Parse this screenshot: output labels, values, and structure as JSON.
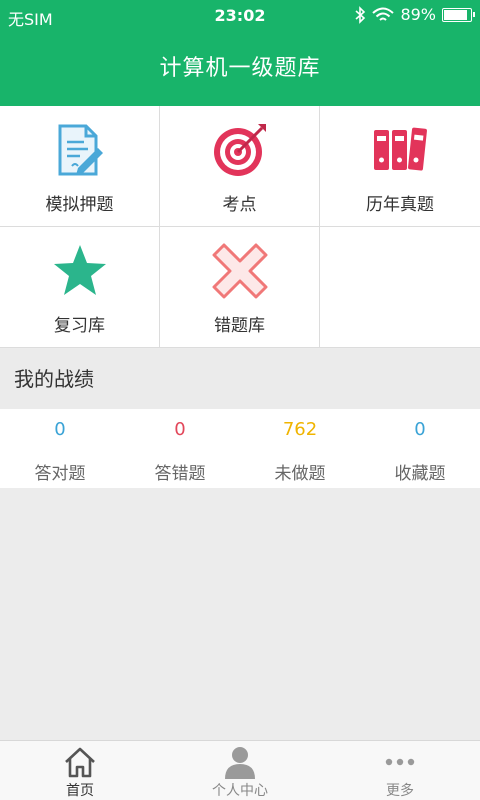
{
  "status": {
    "carrier": "无SIM",
    "time": "23:02",
    "battery_percent": "89%",
    "battery_level": 0.89
  },
  "header": {
    "title": "计算机一级题库"
  },
  "grid": [
    {
      "label": "模拟押题",
      "icon": "document-edit-icon"
    },
    {
      "label": "考点",
      "icon": "target-icon"
    },
    {
      "label": "历年真题",
      "icon": "binders-icon"
    },
    {
      "label": "复习库",
      "icon": "star-icon"
    },
    {
      "label": "错题库",
      "icon": "cross-icon"
    }
  ],
  "section": {
    "title": "我的战绩"
  },
  "stats": [
    {
      "value": "0",
      "label": "答对题",
      "color": "#3aa3d6"
    },
    {
      "value": "0",
      "label": "答错题",
      "color": "#e2475a"
    },
    {
      "value": "762",
      "label": "未做题",
      "color": "#f0b400"
    },
    {
      "value": "0",
      "label": "收藏题",
      "color": "#3aa3d6"
    }
  ],
  "tabs": [
    {
      "label": "首页",
      "icon": "home-icon",
      "active": true
    },
    {
      "label": "个人中心",
      "icon": "user-icon",
      "active": false
    },
    {
      "label": "更多",
      "icon": "more-dots-icon",
      "active": false
    }
  ],
  "colors": {
    "brand": "#18b46a",
    "icon_blue": "#4aa8d8",
    "icon_red": "#e2345a",
    "icon_green": "#2bb58c",
    "icon_pink": "#f07878"
  }
}
